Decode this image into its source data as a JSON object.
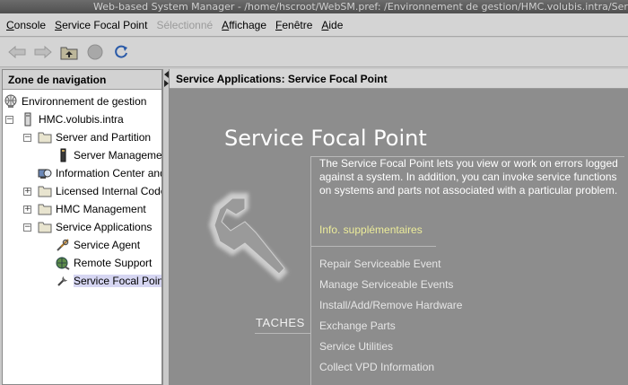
{
  "window": {
    "title": "Web-based System Manager - /home/hscroot/WebSM.pref: /Environnement de gestion/HMC.volubis.intra/Service"
  },
  "menubar": {
    "items": [
      {
        "label": "Console",
        "enabled": true
      },
      {
        "label": "Service Focal Point",
        "enabled": true
      },
      {
        "label": "Sélectionné",
        "enabled": false
      },
      {
        "label": "Affichage",
        "enabled": true
      },
      {
        "label": "Fenêtre",
        "enabled": true
      },
      {
        "label": "Aide",
        "enabled": true
      }
    ]
  },
  "toolbar": {
    "buttons": [
      {
        "icon": "back-arrow-icon",
        "enabled": false
      },
      {
        "icon": "forward-arrow-icon",
        "enabled": false
      },
      {
        "icon": "up-folder-icon",
        "enabled": true
      },
      {
        "icon": "stop-icon",
        "enabled": false
      },
      {
        "icon": "refresh-icon",
        "enabled": true
      }
    ]
  },
  "navigation": {
    "header": "Zone de navigation",
    "tree": [
      {
        "label": "Environnement de gestion",
        "level": 0,
        "icon": "globe-icon",
        "expander": "none"
      },
      {
        "label": "HMC.volubis.intra",
        "level": 0,
        "icon": "server-icon",
        "expander": "minus"
      },
      {
        "label": "Server and Partition",
        "level": 1,
        "icon": "folder-icon",
        "expander": "minus"
      },
      {
        "label": "Server Management",
        "level": 2,
        "icon": "server-tower-icon",
        "expander": "none"
      },
      {
        "label": "Information Center and Setup Wizard",
        "level": 1,
        "icon": "info-center-icon",
        "expander": "none"
      },
      {
        "label": "Licensed Internal Code Maintenance",
        "level": 1,
        "icon": "folder-icon",
        "expander": "plus"
      },
      {
        "label": "HMC Management",
        "level": 1,
        "icon": "folder-icon",
        "expander": "plus"
      },
      {
        "label": "Service Applications",
        "level": 1,
        "icon": "folder-icon",
        "expander": "minus"
      },
      {
        "label": "Service Agent",
        "level": 2,
        "icon": "tools-icon",
        "expander": "none"
      },
      {
        "label": "Remote Support",
        "level": 2,
        "icon": "remote-support-icon",
        "expander": "none"
      },
      {
        "label": "Service Focal Point",
        "level": 2,
        "icon": "wrench-icon",
        "expander": "none",
        "selected": true
      }
    ]
  },
  "content": {
    "header": "Service Applications: Service Focal Point",
    "title": "Service Focal Point",
    "description": "The Service Focal Point lets you view or work on errors logged against a system.  In addition, you can invoke service functions on systems and parts not associated with a particular problem.",
    "more_info": "Info. supplémentaires",
    "tasks_label": "TACHES",
    "tasks": [
      "Repair Serviceable Event",
      "Manage Serviceable Events",
      "Install/Add/Remove Hardware",
      "Exchange Parts",
      "Service Utilities",
      "Collect VPD Information"
    ]
  },
  "colors": {
    "content_background": "#8d8d8d",
    "more_info_link": "#ecec9a",
    "selection": "#d6d6f2"
  }
}
